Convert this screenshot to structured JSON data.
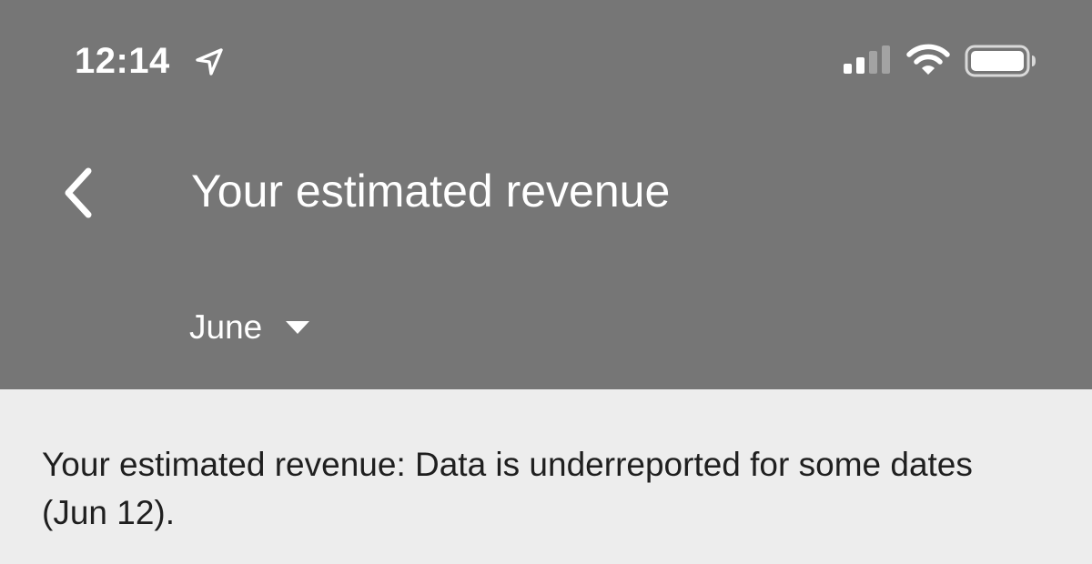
{
  "status_bar": {
    "time": "12:14",
    "icons": [
      "location-arrow-icon",
      "cellular-signal-icon",
      "wifi-icon",
      "battery-icon"
    ]
  },
  "header": {
    "back_icon": "chevron-left-icon",
    "title": "Your estimated revenue",
    "month_selector": {
      "selected": "June",
      "icon": "caret-down-icon"
    }
  },
  "notice": {
    "text": "Your estimated revenue: Data is underreported for some dates (Jun 12)."
  },
  "colors": {
    "header_bg": "#767676",
    "content_bg": "#ededed",
    "header_text": "#ffffff",
    "body_text": "#1f1f1f"
  }
}
